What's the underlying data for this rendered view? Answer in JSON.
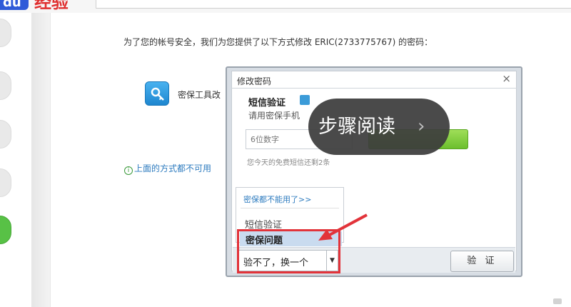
{
  "header": {
    "logo_badge": "du",
    "logo_text": "经验"
  },
  "page": {
    "notice": "为了您的帐号安全，我们为您提供了以下方式修改 ERIC(2733775767) 的密码：",
    "key_tool_label": "密保工具改",
    "info_line": "上面的方式都不可用"
  },
  "dialog": {
    "title": "修改密码",
    "close": "×",
    "sms_title": "短信验证",
    "sms_desc": "请用密保手机",
    "code_placeholder": "6位数字",
    "quota": "您今天的免费短信还剩2条",
    "options": {
      "unavailable_link": "密保都不能用了>>",
      "sms": "短信验证",
      "question": "密保问题"
    },
    "select_value": "验不了，换一个",
    "select_arrow": "▼",
    "verify_button": "验 证"
  },
  "overlay": {
    "step_read": "步骤阅读",
    "chevron": "›"
  },
  "colors": {
    "highlight": "#e2333a",
    "accent_blue": "#2d7bbf",
    "green_button": "#6cbf2d"
  },
  "icons": {
    "key": "key-icon",
    "info": "info-icon",
    "close": "close-icon",
    "dropdown": "chevron-down-icon",
    "arrow": "arrow-pointer-icon"
  }
}
